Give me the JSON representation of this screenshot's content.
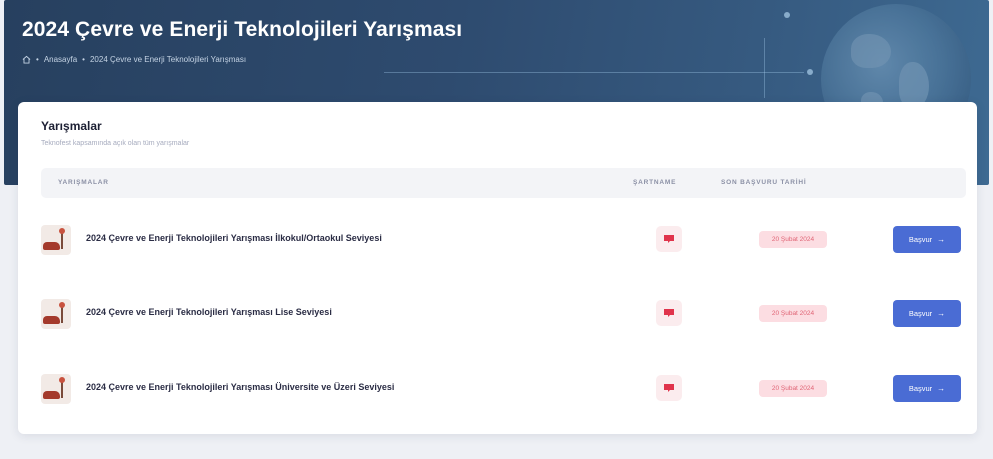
{
  "header": {
    "title": "2024 Çevre ve Enerji Teknolojileri Yarışması",
    "breadcrumb": {
      "home_icon": "home-icon",
      "separator": "•",
      "items": [
        "Anasayfa",
        "2024 Çevre ve Enerji Teknolojileri Yarışması"
      ]
    }
  },
  "card": {
    "title": "Yarışmalar",
    "subtitle": "Teknofest kapsamında açık olan tüm yarışmalar",
    "columns": [
      "YARIŞMALAR",
      "ŞARTNAME",
      "SON BAŞVURU TARİHİ"
    ],
    "rows": [
      {
        "title": "2024 Çevre ve Enerji Teknolojileri Yarışması İlkokul/Ortaokul Seviyesi",
        "deadline": "20 Şubat 2024",
        "apply_label": "Başvur",
        "apply_icon": "arrow-right-icon",
        "doc_icon": "document-icon"
      },
      {
        "title": "2024 Çevre ve Enerji Teknolojileri Yarışması Lise Seviyesi",
        "deadline": "20 Şubat 2024",
        "apply_label": "Başvur",
        "apply_icon": "arrow-right-icon",
        "doc_icon": "document-icon"
      },
      {
        "title": "2024 Çevre ve Enerji Teknolojileri Yarışması Üniversite ve Üzeri Seviyesi",
        "deadline": "20 Şubat 2024",
        "apply_label": "Başvur",
        "apply_icon": "arrow-right-icon",
        "doc_icon": "document-icon"
      }
    ]
  },
  "colors": {
    "hero": "#2e4b6f",
    "primary_button": "#4a6cd4",
    "deadline_bg": "#fcdde2",
    "deadline_text": "#e06576",
    "doc_icon": "#e0344c"
  }
}
